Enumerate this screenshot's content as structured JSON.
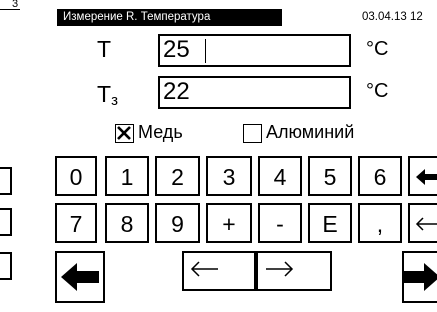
{
  "side_window": {
    "title_fragment": "3"
  },
  "window": {
    "title": "Измерение R. Температура",
    "datetime": "03.04.13 12"
  },
  "fields": {
    "t": {
      "label": "T",
      "value": "25",
      "unit": "°C"
    },
    "t3": {
      "label": "T",
      "subscript": "з",
      "value": "22",
      "unit": "°C"
    }
  },
  "material": {
    "copper": {
      "label": "Медь",
      "checked": true
    },
    "aluminum": {
      "label": "Алюминий",
      "checked": false
    }
  },
  "keypad": {
    "row1": [
      "0",
      "1",
      "2",
      "3",
      "4",
      "5",
      "6"
    ],
    "row2": [
      "7",
      "8",
      "9",
      "+",
      "-",
      "E",
      ","
    ],
    "backspace_icon": "backspace-arrow-icon",
    "small_left_icon": "arrow-left-icon",
    "cursor_left_icon": "arrow-left-icon",
    "cursor_right_icon": "arrow-right-icon",
    "nav_back_icon": "big-arrow-left-icon",
    "nav_forward_icon": "big-arrow-right-icon"
  }
}
